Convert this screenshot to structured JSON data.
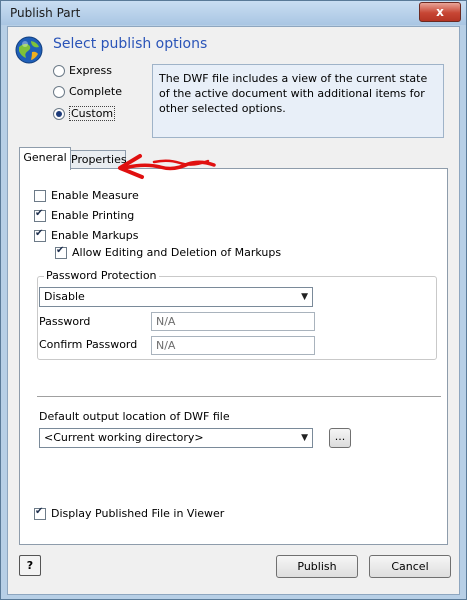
{
  "window": {
    "title": "Publish Part",
    "close_label": "x"
  },
  "header": {
    "heading": "Select publish options",
    "logo_icon": "globe-logo-icon"
  },
  "options": {
    "express": "Express",
    "complete": "Complete",
    "custom": "Custom",
    "selected": "Custom"
  },
  "description": "The DWF file includes a view of the current state of the active document with additional items for other selected options.",
  "tabs": [
    {
      "label": "General",
      "active": true
    },
    {
      "label": "Properties",
      "active": false
    }
  ],
  "general": {
    "enable_measure": {
      "label": "Enable Measure",
      "checked": false
    },
    "enable_printing": {
      "label": "Enable Printing",
      "checked": true
    },
    "enable_markups": {
      "label": "Enable Markups",
      "checked": true
    },
    "allow_editing": {
      "label": "Allow Editing and Deletion of Markups",
      "checked": true
    },
    "password_protection": {
      "title": "Password Protection",
      "mode": "Disable",
      "password_label": "Password",
      "password_value": "N/A",
      "confirm_label": "Confirm Password",
      "confirm_value": "N/A"
    },
    "output_location": {
      "label": "Default output location of DWF file",
      "value": "<Current working directory>",
      "browse_label": "..."
    },
    "display_in_viewer": {
      "label": "Display Published File in Viewer",
      "checked": true
    }
  },
  "footer": {
    "help_label": "?",
    "publish": "Publish",
    "cancel": "Cancel"
  },
  "annotation": {
    "color": "#e01010"
  }
}
